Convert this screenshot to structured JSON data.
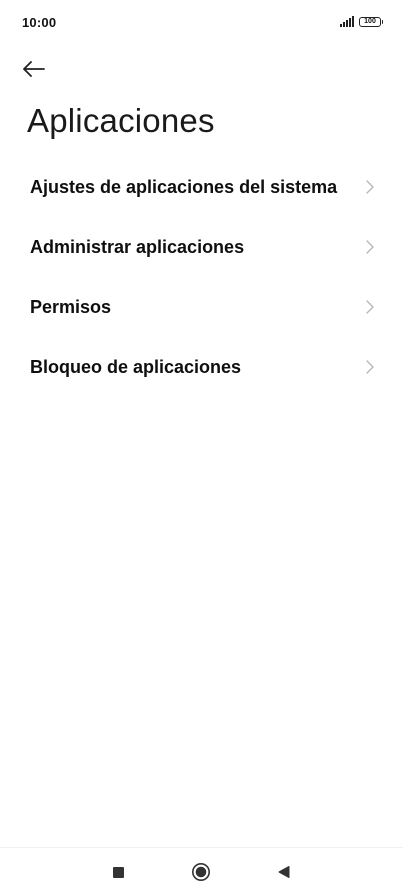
{
  "status_bar": {
    "time": "10:00",
    "battery": "100"
  },
  "header": {
    "title": "Aplicaciones"
  },
  "menu": {
    "items": [
      {
        "label": "Ajustes de aplicaciones del sistema"
      },
      {
        "label": "Administrar aplicaciones"
      },
      {
        "label": "Permisos"
      },
      {
        "label": "Bloqueo de aplicaciones"
      }
    ]
  },
  "icons": {
    "back": "arrow-left-icon",
    "chevron": "chevron-right-icon",
    "signal": "signal-icon",
    "battery": "battery-icon",
    "recents": "square-icon",
    "home": "circle-icon",
    "nav_back": "triangle-left-icon"
  },
  "colors": {
    "background": "#ffffff",
    "text": "#0f0f0f",
    "chevron": "#b5b5b5"
  }
}
